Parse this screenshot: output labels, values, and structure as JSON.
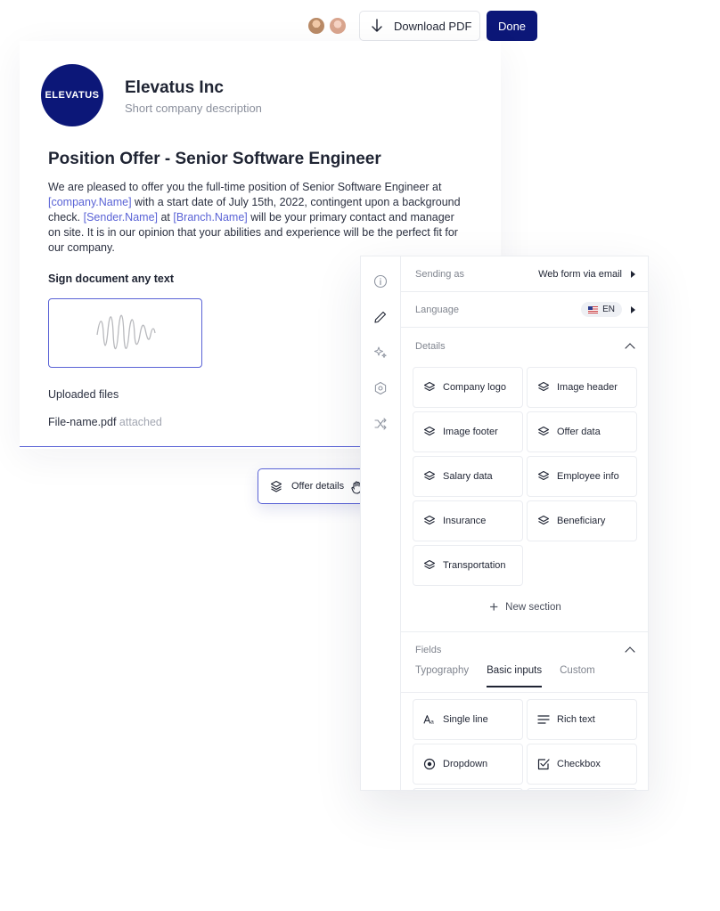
{
  "topbar": {
    "download_label": "Download PDF",
    "done_label": "Done"
  },
  "company": {
    "logo_text": "ELEVATUS",
    "name": "Elevatus Inc",
    "description": "Short company description"
  },
  "document": {
    "title": "Position Offer - Senior Software Engineer",
    "body_part1": "We are pleased to offer you the full-time position of Senior Software Engineer at ",
    "token_company": "[company.Name]",
    "body_part2": " with a start date of July 15th, 2022, contingent upon a background check. ",
    "token_sender": "[Sender.Name]",
    "body_part3": " at ",
    "token_branch": "[Branch.Name]",
    "body_part4": " will be your primary contact and manager on site. It is in our opinion that your abilities and experience will be the perfect fit for our company.",
    "sign_label": "Sign document any text",
    "files_label": "Uploaded files",
    "file_name": "File-name.pdf",
    "file_status": "attached"
  },
  "drag_chip": {
    "label": "Offer details"
  },
  "panel": {
    "sending_as_label": "Sending as",
    "sending_as_value": "Web form via email",
    "language_label": "Language",
    "language_value": "EN",
    "details_label": "Details",
    "detail_tiles": [
      "Company logo",
      "Image header",
      "Image footer",
      "Offer data",
      "Salary data",
      "Employee info",
      "Insurance",
      "Beneficiary",
      "Transportation"
    ],
    "new_section_label": "New section",
    "fields_label": "Fields",
    "tabs": [
      "Typography",
      "Basic inputs",
      "Custom"
    ],
    "active_tab": "Basic inputs",
    "field_tiles": [
      "Single line",
      "Rich text",
      "Dropdown",
      "Checkbox"
    ]
  },
  "colors": {
    "primary": "#0c1778",
    "accent": "#5a63d6",
    "border": "#ebedf1"
  }
}
